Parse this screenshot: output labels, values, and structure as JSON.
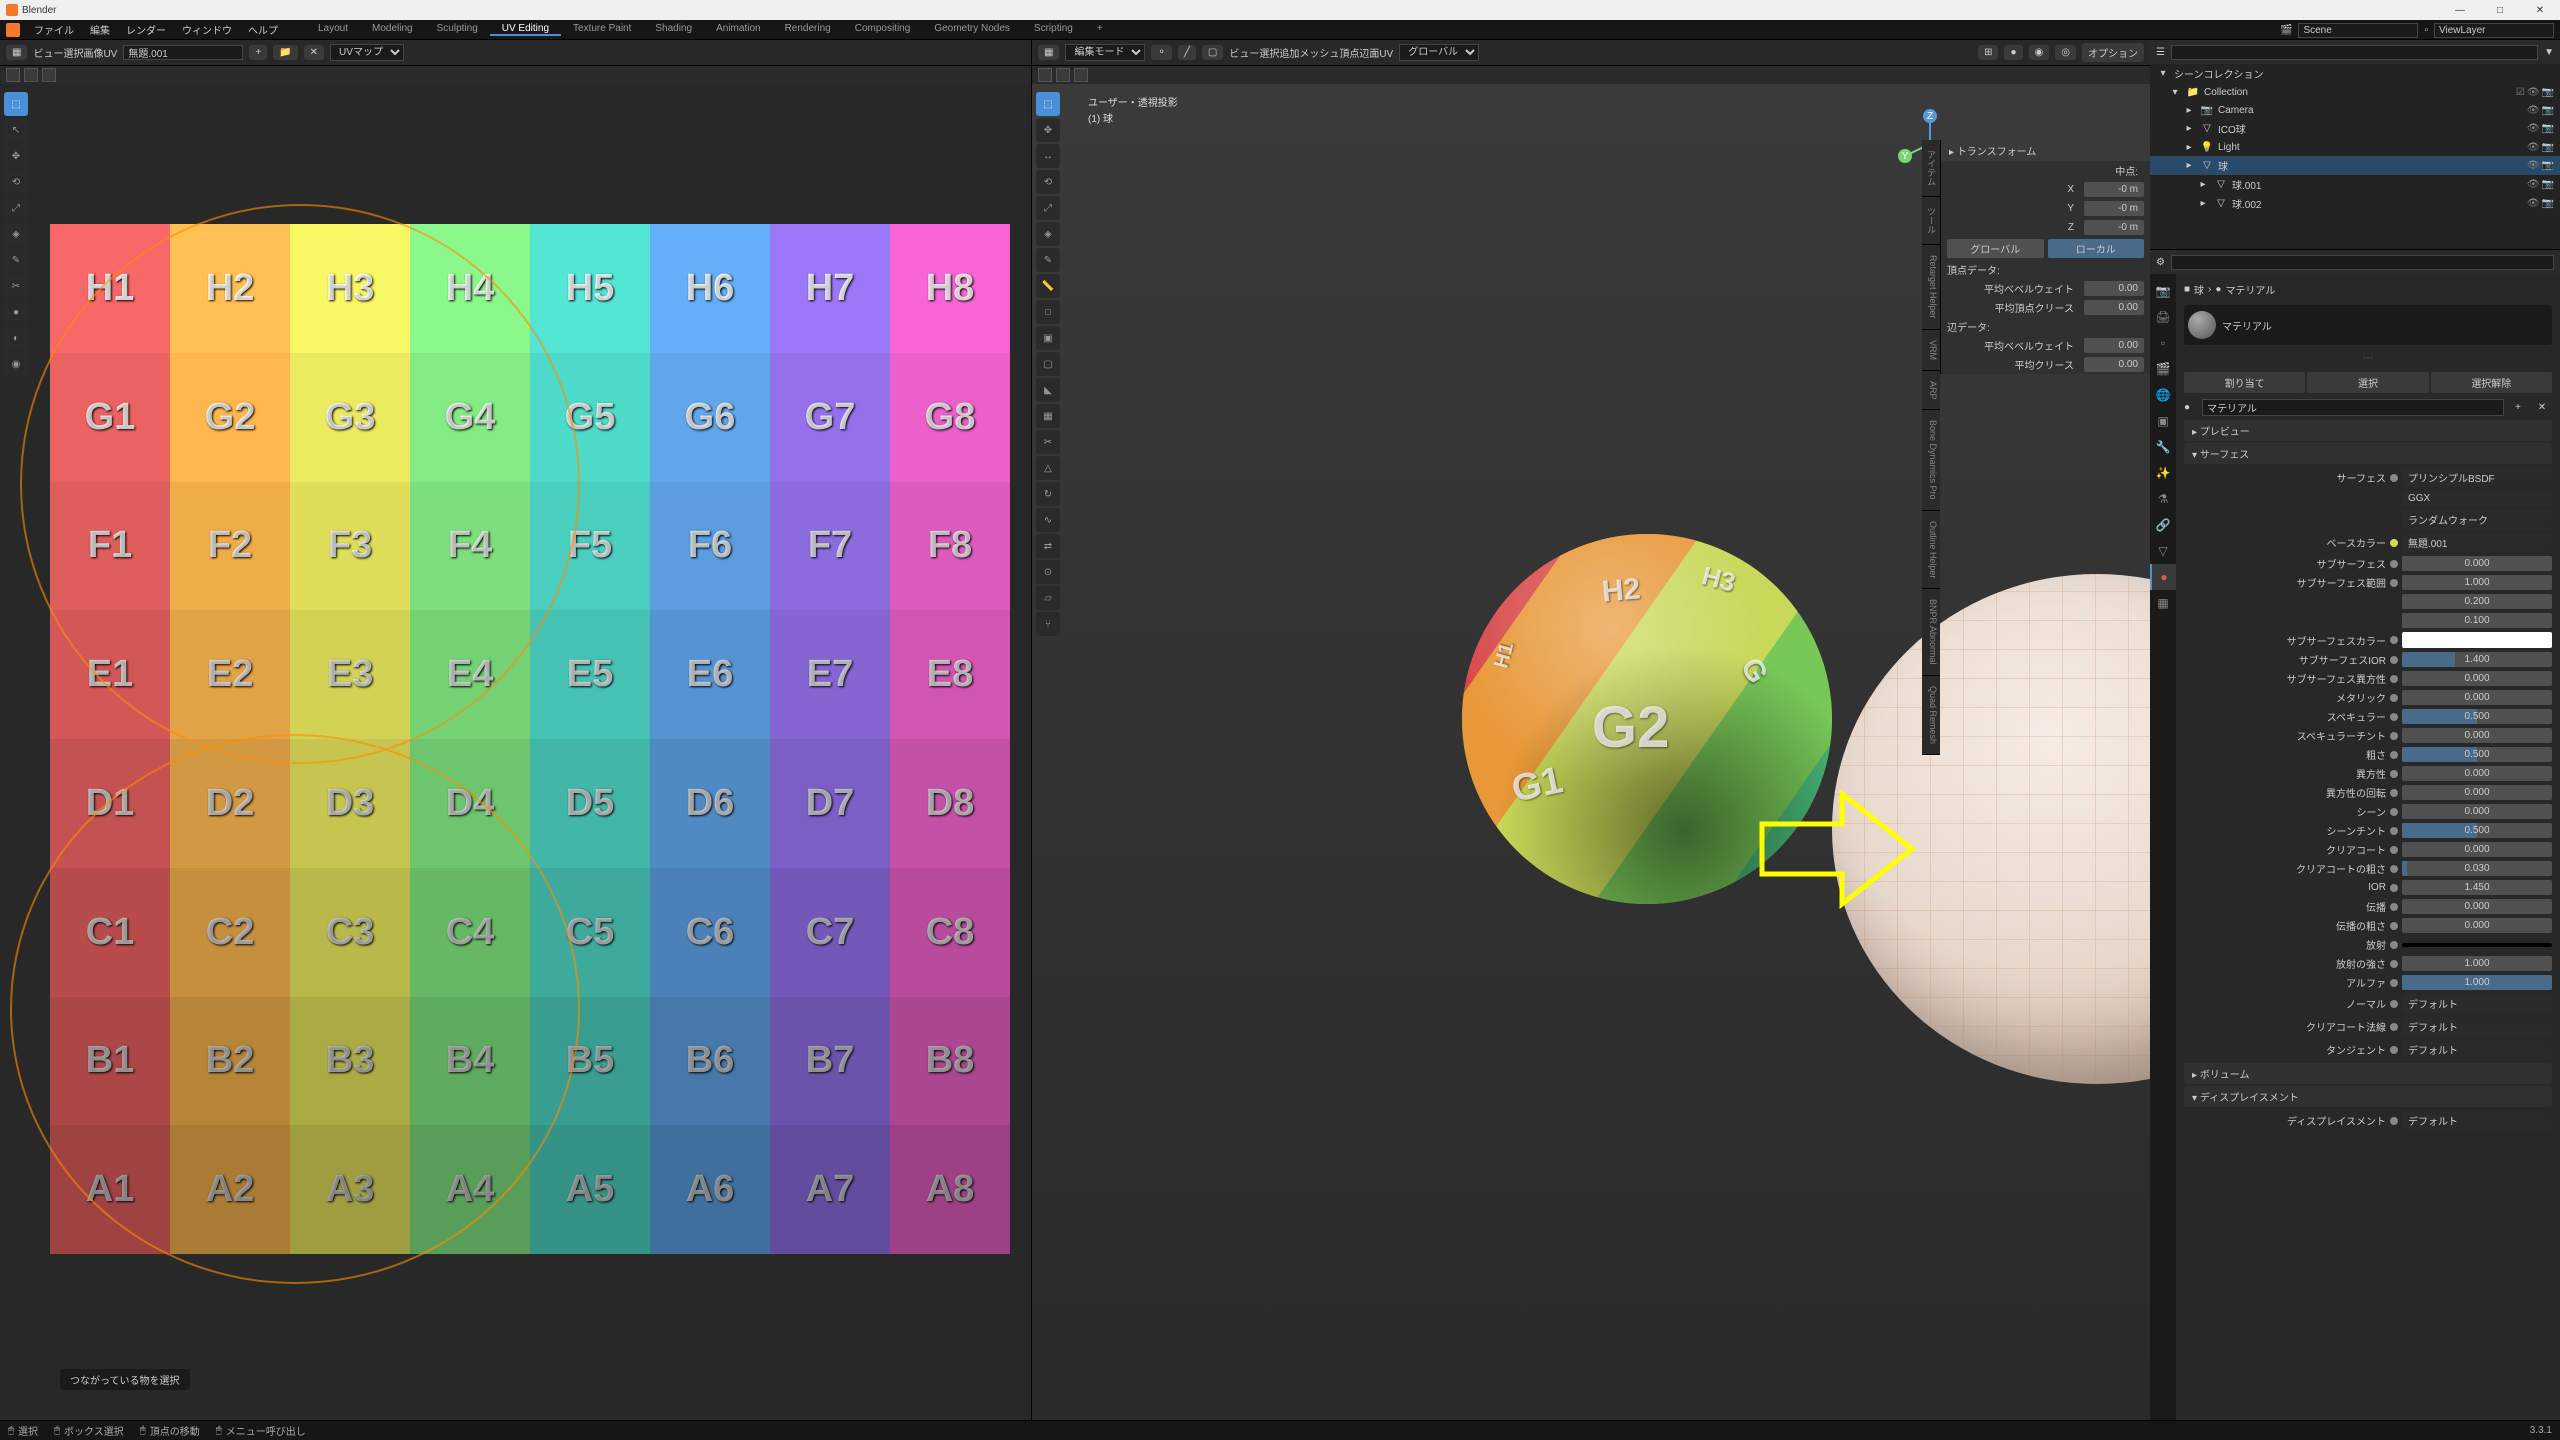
{
  "app": {
    "title": "Blender"
  },
  "menus": [
    "ファイル",
    "編集",
    "レンダー",
    "ウィンドウ",
    "ヘルプ"
  ],
  "workspaces": [
    "Layout",
    "Modeling",
    "Sculpting",
    "UV Editing",
    "Texture Paint",
    "Shading",
    "Animation",
    "Rendering",
    "Compositing",
    "Geometry Nodes",
    "Scripting",
    "+"
  ],
  "active_workspace": "UV Editing",
  "scene": {
    "name": "Scene",
    "layer": "ViewLayer"
  },
  "uv": {
    "image": "無題.001",
    "mode": "UVマップ",
    "menus": [
      "ビュー",
      "選択",
      "画像",
      "UV"
    ],
    "rows": [
      "H",
      "G",
      "F",
      "E",
      "D",
      "C",
      "B",
      "A"
    ],
    "cols": [
      "1",
      "2",
      "3",
      "4",
      "5",
      "6",
      "7",
      "8"
    ],
    "colors": [
      "#d85a5a",
      "#e8a848",
      "#d8d858",
      "#78d878",
      "#48c8b8",
      "#5898d8",
      "#8868d8",
      "#d858b8"
    ]
  },
  "vp": {
    "mode": "編集モード",
    "menus": [
      "ビュー",
      "選択",
      "追加",
      "メッシュ",
      "頂点",
      "辺",
      "面",
      "UV"
    ],
    "orient": "グローバル",
    "info1": "ユーザー・透視投影",
    "info2": "(1) 球",
    "options": "オプション"
  },
  "nside": {
    "transform": "トランスフォーム",
    "center": "中点:",
    "x": "X",
    "xv": "-0 m",
    "y": "Y",
    "yv": "-0 m",
    "z": "Z",
    "zv": "-0 m",
    "global": "グローバル",
    "local": "ローカル",
    "vdata": "頂点データ:",
    "bevel_w": "平均ベベルウェイト",
    "bevel_wv": "0.00",
    "vcrease": "平均頂点クリース",
    "vcreasev": "0.00",
    "edata": "辺データ:",
    "ebevel": "平均ベベルウェイト",
    "ebevelv": "0.00",
    "ecrease": "平均クリース",
    "ecreasev": "0.00",
    "tabs": [
      "アイテム",
      "ツール",
      "Retarget Helper",
      "VRM",
      "ARP",
      "Bone Dynamics Pro",
      "Outline Helper",
      "BNPR Abnormal",
      "Quad Remesh"
    ]
  },
  "outliner": {
    "collection": "Collection",
    "items": [
      {
        "name": "Camera",
        "icon": "📷",
        "depth": 1
      },
      {
        "name": "ICO球",
        "icon": "▽",
        "depth": 1,
        "vis": false
      },
      {
        "name": "Light",
        "icon": "💡",
        "depth": 1
      },
      {
        "name": "球",
        "icon": "▽",
        "depth": 1,
        "sel": true
      },
      {
        "name": "球.001",
        "icon": "▽",
        "depth": 2
      },
      {
        "name": "球.002",
        "icon": "▽",
        "depth": 2
      }
    ],
    "scene_coll": "シーンコレクション"
  },
  "props": {
    "breadcrumb": [
      "球",
      "マテリアル"
    ],
    "material": "マテリアル",
    "assign": "割り当て",
    "select": "選択",
    "deselect": "選択解除",
    "preview": "プレビュー",
    "surface_hdr": "サーフェス",
    "surface": "サーフェス",
    "surface_v": "プリンシプルBSDF",
    "ggx": "GGX",
    "walk": "ランダムウォーク",
    "basecolor": "ベースカラー",
    "basecolor_v": "無題.001",
    "subsurf": "サブサーフェス",
    "subsurf_v": "0.000",
    "subsurf_r": "サブサーフェス範囲",
    "subsurf_rv1": "1.000",
    "subsurf_rv2": "0.200",
    "subsurf_rv3": "0.100",
    "subsurf_c": "サブサーフェスカラー",
    "subsurf_ior": "サブサーフェスIOR",
    "subsurf_iorv": "1.400",
    "subsurf_a": "サブサーフェス異方性",
    "subsurf_av": "0.000",
    "metallic": "メタリック",
    "metallic_v": "0.000",
    "specular": "スペキュラー",
    "specular_v": "0.500",
    "spec_tint": "スペキュラーチント",
    "spec_tint_v": "0.000",
    "rough": "粗さ",
    "rough_v": "0.500",
    "aniso": "異方性",
    "aniso_v": "0.000",
    "aniso_r": "異方性の回転",
    "aniso_rv": "0.000",
    "sheen": "シーン",
    "sheen_v": "0.000",
    "sheen_t": "シーンチント",
    "sheen_tv": "0.500",
    "clearcoat": "クリアコート",
    "clearcoat_v": "0.000",
    "cc_rough": "クリアコートの粗さ",
    "cc_rough_v": "0.030",
    "ior": "IOR",
    "ior_v": "1.450",
    "trans": "伝播",
    "trans_v": "0.000",
    "trans_r": "伝播の粗さ",
    "trans_rv": "0.000",
    "emit": "放射",
    "emit_s": "放射の強さ",
    "emit_sv": "1.000",
    "alpha": "アルファ",
    "alpha_v": "1.000",
    "normal": "ノーマル",
    "normal_v": "デフォルト",
    "cc_norm": "クリアコート法線",
    "cc_norm_v": "デフォルト",
    "tangent": "タンジェント",
    "tangent_v": "デフォルト",
    "volume": "ボリューム",
    "displace": "ディスプレイスメント",
    "disp_v": "ディスプレイスメント",
    "disp_vv": "デフォルト"
  },
  "status": {
    "hint": "つながっている物を選択",
    "select": "選択",
    "box": "ボックス選択",
    "move": "頂点の移動",
    "menu": "メニュー呼び出し",
    "ver": "3.3.1"
  }
}
